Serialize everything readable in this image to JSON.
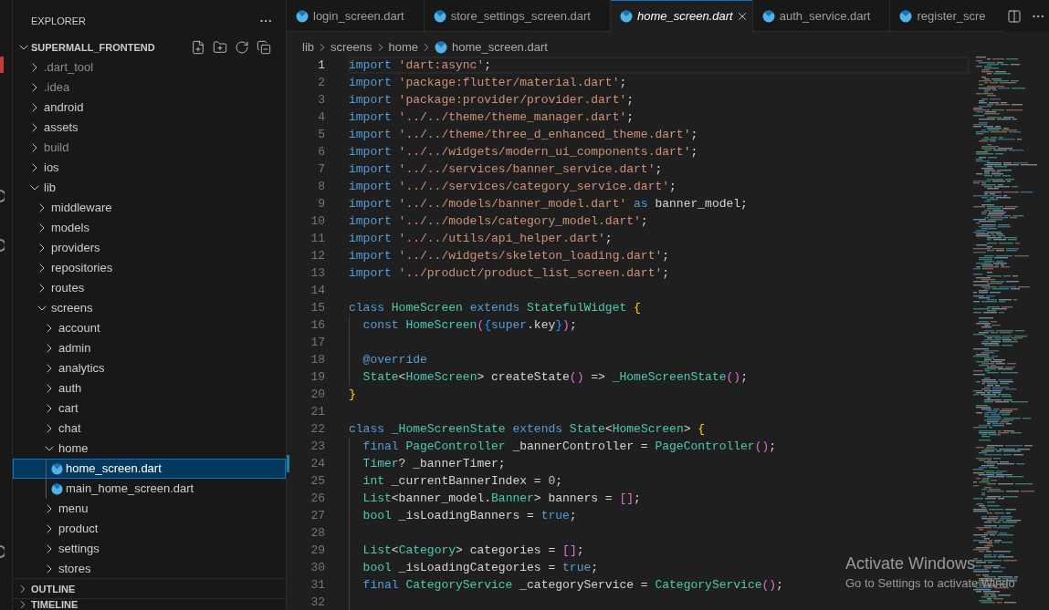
{
  "sidebar": {
    "title": "EXPLORER",
    "root": {
      "label": "SUPERMALL_FRONTEND",
      "expanded": true,
      "children": [
        {
          "label": ".dart_tool",
          "kind": "folder",
          "expanded": false,
          "selected": false,
          "ignored": true
        },
        {
          "label": ".idea",
          "kind": "folder",
          "expanded": false,
          "selected": false,
          "ignored": true
        },
        {
          "label": "android",
          "kind": "folder",
          "expanded": false,
          "selected": false,
          "ignored": false
        },
        {
          "label": "assets",
          "kind": "folder",
          "expanded": false,
          "selected": false,
          "ignored": false
        },
        {
          "label": "build",
          "kind": "folder",
          "expanded": false,
          "selected": false,
          "ignored": true
        },
        {
          "label": "ios",
          "kind": "folder",
          "expanded": false,
          "selected": false,
          "ignored": false
        },
        {
          "label": "lib",
          "kind": "folder",
          "expanded": true,
          "selected": false,
          "ignored": false,
          "children": [
            {
              "label": "middleware",
              "kind": "folder",
              "expanded": false,
              "selected": false,
              "ignored": false
            },
            {
              "label": "models",
              "kind": "folder",
              "expanded": false,
              "selected": false,
              "ignored": false
            },
            {
              "label": "providers",
              "kind": "folder",
              "expanded": false,
              "selected": false,
              "ignored": false
            },
            {
              "label": "repositories",
              "kind": "folder",
              "expanded": false,
              "selected": false,
              "ignored": false
            },
            {
              "label": "routes",
              "kind": "folder",
              "expanded": false,
              "selected": false,
              "ignored": false
            },
            {
              "label": "screens",
              "kind": "folder",
              "expanded": true,
              "selected": false,
              "ignored": false,
              "children": [
                {
                  "label": "account",
                  "kind": "folder",
                  "expanded": false,
                  "selected": false,
                  "ignored": false
                },
                {
                  "label": "admin",
                  "kind": "folder",
                  "expanded": false,
                  "selected": false,
                  "ignored": false
                },
                {
                  "label": "analytics",
                  "kind": "folder",
                  "expanded": false,
                  "selected": false,
                  "ignored": false
                },
                {
                  "label": "auth",
                  "kind": "folder",
                  "expanded": false,
                  "selected": false,
                  "ignored": false
                },
                {
                  "label": "cart",
                  "kind": "folder",
                  "expanded": false,
                  "selected": false,
                  "ignored": false
                },
                {
                  "label": "chat",
                  "kind": "folder",
                  "expanded": false,
                  "selected": false,
                  "ignored": false
                },
                {
                  "label": "home",
                  "kind": "folder",
                  "expanded": true,
                  "selected": false,
                  "ignored": false,
                  "children": [
                    {
                      "label": "home_screen.dart",
                      "kind": "file",
                      "selected": true,
                      "ignored": false
                    },
                    {
                      "label": "main_home_screen.dart",
                      "kind": "file",
                      "selected": false,
                      "ignored": false
                    }
                  ]
                },
                {
                  "label": "menu",
                  "kind": "folder",
                  "expanded": false,
                  "selected": false,
                  "ignored": false
                },
                {
                  "label": "product",
                  "kind": "folder",
                  "expanded": false,
                  "selected": false,
                  "ignored": false
                },
                {
                  "label": "settings",
                  "kind": "folder",
                  "expanded": false,
                  "selected": false,
                  "ignored": false
                },
                {
                  "label": "stores",
                  "kind": "folder",
                  "expanded": false,
                  "selected": false,
                  "ignored": false
                }
              ]
            }
          ]
        }
      ]
    },
    "sections": [
      {
        "label": "OUTLINE",
        "expanded": false
      },
      {
        "label": "TIMELINE",
        "expanded": false
      }
    ]
  },
  "editor": {
    "tabs": [
      {
        "label": "login_screen.dart",
        "selected": false,
        "preview": false
      },
      {
        "label": "store_settings_screen.dart",
        "selected": false,
        "preview": false
      },
      {
        "label": "home_screen.dart",
        "selected": true,
        "preview": true
      },
      {
        "label": "auth_service.dart",
        "selected": false,
        "preview": false
      },
      {
        "label": "register_scre",
        "selected": false,
        "preview": false
      }
    ],
    "breadcrumbs": {
      "folders": [
        "lib",
        "screens",
        "home"
      ],
      "file": "home_screen.dart"
    },
    "lines": [
      {
        "number": "1",
        "current": true,
        "modified": false,
        "tokens": [
          {
            "kind": "keyword",
            "text": "import "
          },
          {
            "kind": "string",
            "text": "'dart:async'"
          },
          {
            "kind": "plain",
            "text": ";"
          }
        ]
      },
      {
        "number": "2",
        "current": false,
        "modified": false,
        "tokens": [
          {
            "kind": "keyword",
            "text": "import "
          },
          {
            "kind": "string",
            "text": "'package:flutter/material.dart'"
          },
          {
            "kind": "plain",
            "text": ";"
          }
        ]
      },
      {
        "number": "3",
        "current": false,
        "modified": false,
        "tokens": [
          {
            "kind": "keyword",
            "text": "import "
          },
          {
            "kind": "string",
            "text": "'package:provider/provider.dart'"
          },
          {
            "kind": "plain",
            "text": ";"
          }
        ]
      },
      {
        "number": "4",
        "current": false,
        "modified": false,
        "tokens": [
          {
            "kind": "keyword",
            "text": "import "
          },
          {
            "kind": "string",
            "text": "'../../theme/theme_manager.dart'"
          },
          {
            "kind": "plain",
            "text": ";"
          }
        ]
      },
      {
        "number": "5",
        "current": false,
        "modified": false,
        "tokens": [
          {
            "kind": "keyword",
            "text": "import "
          },
          {
            "kind": "string",
            "text": "'../../theme/three_d_enhanced_theme.dart'"
          },
          {
            "kind": "plain",
            "text": ";"
          }
        ]
      },
      {
        "number": "6",
        "current": false,
        "modified": false,
        "tokens": [
          {
            "kind": "keyword",
            "text": "import "
          },
          {
            "kind": "string",
            "text": "'../../widgets/modern_ui_components.dart'"
          },
          {
            "kind": "plain",
            "text": ";"
          }
        ]
      },
      {
        "number": "7",
        "current": false,
        "modified": false,
        "tokens": [
          {
            "kind": "keyword",
            "text": "import "
          },
          {
            "kind": "string",
            "text": "'../../services/banner_service.dart'"
          },
          {
            "kind": "plain",
            "text": ";"
          }
        ]
      },
      {
        "number": "8",
        "current": false,
        "modified": false,
        "tokens": [
          {
            "kind": "keyword",
            "text": "import "
          },
          {
            "kind": "string",
            "text": "'../../services/category_service.dart'"
          },
          {
            "kind": "plain",
            "text": ";"
          }
        ]
      },
      {
        "number": "9",
        "current": false,
        "modified": false,
        "tokens": [
          {
            "kind": "keyword",
            "text": "import "
          },
          {
            "kind": "string",
            "text": "'../../models/banner_model.dart'"
          },
          {
            "kind": "keyword",
            "text": " as "
          },
          {
            "kind": "plain",
            "text": "banner_model;"
          }
        ]
      },
      {
        "number": "10",
        "current": false,
        "modified": false,
        "tokens": [
          {
            "kind": "keyword",
            "text": "import "
          },
          {
            "kind": "string",
            "text": "'../../models/category_model.dart'"
          },
          {
            "kind": "plain",
            "text": ";"
          }
        ]
      },
      {
        "number": "11",
        "current": false,
        "modified": false,
        "tokens": [
          {
            "kind": "keyword",
            "text": "import "
          },
          {
            "kind": "string",
            "text": "'../../utils/api_helper.dart'"
          },
          {
            "kind": "plain",
            "text": ";"
          }
        ]
      },
      {
        "number": "12",
        "current": false,
        "modified": false,
        "tokens": [
          {
            "kind": "keyword",
            "text": "import "
          },
          {
            "kind": "string",
            "text": "'../../widgets/skeleton_loading.dart'"
          },
          {
            "kind": "plain",
            "text": ";"
          }
        ]
      },
      {
        "number": "13",
        "current": false,
        "modified": false,
        "tokens": [
          {
            "kind": "keyword",
            "text": "import "
          },
          {
            "kind": "string",
            "text": "'../product/product_list_screen.dart'"
          },
          {
            "kind": "plain",
            "text": ";"
          }
        ]
      },
      {
        "number": "14",
        "current": false,
        "modified": false
      },
      {
        "number": "15",
        "current": false,
        "modified": false,
        "tokens": [
          {
            "kind": "keyword",
            "text": "class "
          },
          {
            "kind": "type",
            "text": "HomeScreen"
          },
          {
            "kind": "keyword",
            "text": " extends "
          },
          {
            "kind": "type",
            "text": "StatefulWidget"
          },
          {
            "kind": "bracket_outer",
            "text": " {"
          }
        ],
        "children": [
          {
            "number": "16",
            "current": false,
            "modified": false,
            "tokens": [
              {
                "kind": "keyword",
                "text": "const "
              },
              {
                "kind": "type",
                "text": "HomeScreen"
              },
              {
                "kind": "bracket_middle",
                "text": "("
              },
              {
                "kind": "bracket_inner",
                "text": "{"
              },
              {
                "kind": "keyword",
                "text": "super"
              },
              {
                "kind": "plain",
                "text": ".key"
              },
              {
                "kind": "bracket_inner",
                "text": "}"
              },
              {
                "kind": "bracket_middle",
                "text": ")"
              },
              {
                "kind": "plain",
                "text": ";"
              }
            ]
          },
          {
            "number": "17",
            "current": false,
            "modified": false
          },
          {
            "number": "18",
            "current": false,
            "modified": false,
            "tokens": [
              {
                "kind": "keyword",
                "text": "@override"
              }
            ]
          },
          {
            "number": "19",
            "current": false,
            "modified": false,
            "tokens": [
              {
                "kind": "type",
                "text": "State"
              },
              {
                "kind": "plain",
                "text": "<"
              },
              {
                "kind": "type",
                "text": "HomeScreen"
              },
              {
                "kind": "plain",
                "text": "> createState"
              },
              {
                "kind": "bracket_middle",
                "text": "()"
              },
              {
                "kind": "plain",
                "text": " => "
              },
              {
                "kind": "type",
                "text": "_HomeScreenState"
              },
              {
                "kind": "bracket_middle",
                "text": "()"
              },
              {
                "kind": "plain",
                "text": ";"
              }
            ]
          }
        ]
      },
      {
        "number": "20",
        "current": false,
        "modified": false,
        "tokens": [
          {
            "kind": "bracket_outer",
            "text": "}"
          }
        ]
      },
      {
        "number": "21",
        "current": false,
        "modified": false
      },
      {
        "number": "22",
        "current": false,
        "modified": false,
        "tokens": [
          {
            "kind": "keyword",
            "text": "class "
          },
          {
            "kind": "type",
            "text": "_HomeScreenState"
          },
          {
            "kind": "keyword",
            "text": " extends "
          },
          {
            "kind": "type",
            "text": "State"
          },
          {
            "kind": "plain",
            "text": "<"
          },
          {
            "kind": "type",
            "text": "HomeScreen"
          },
          {
            "kind": "plain",
            "text": ">"
          },
          {
            "kind": "bracket_outer",
            "text": " {"
          }
        ],
        "children": [
          {
            "number": "23",
            "current": false,
            "modified": false,
            "tokens": [
              {
                "kind": "keyword",
                "text": "final "
              },
              {
                "kind": "type",
                "text": "PageController"
              },
              {
                "kind": "plain",
                "text": " _bannerController = "
              },
              {
                "kind": "type",
                "text": "PageController"
              },
              {
                "kind": "bracket_middle",
                "text": "()"
              },
              {
                "kind": "plain",
                "text": ";"
              }
            ]
          },
          {
            "number": "24",
            "current": false,
            "modified": true,
            "tokens": [
              {
                "kind": "type",
                "text": "Timer"
              },
              {
                "kind": "plain",
                "text": "? _bannerTimer;"
              }
            ]
          },
          {
            "number": "25",
            "current": false,
            "modified": false,
            "tokens": [
              {
                "kind": "type",
                "text": "int"
              },
              {
                "kind": "plain",
                "text": " _currentBannerIndex = "
              },
              {
                "kind": "number",
                "text": "0"
              },
              {
                "kind": "plain",
                "text": ";"
              }
            ]
          },
          {
            "number": "26",
            "current": false,
            "modified": false,
            "tokens": [
              {
                "kind": "type",
                "text": "List"
              },
              {
                "kind": "plain",
                "text": "<banner_model."
              },
              {
                "kind": "type",
                "text": "Banner"
              },
              {
                "kind": "plain",
                "text": "> banners = "
              },
              {
                "kind": "bracket_middle",
                "text": "[]"
              },
              {
                "kind": "plain",
                "text": ";"
              }
            ]
          },
          {
            "number": "27",
            "current": false,
            "modified": false,
            "tokens": [
              {
                "kind": "type",
                "text": "bool"
              },
              {
                "kind": "plain",
                "text": " _isLoadingBanners = "
              },
              {
                "kind": "keyword",
                "text": "true"
              },
              {
                "kind": "plain",
                "text": ";"
              }
            ]
          },
          {
            "number": "28",
            "current": false,
            "modified": false
          },
          {
            "number": "29",
            "current": false,
            "modified": false,
            "tokens": [
              {
                "kind": "type",
                "text": "List"
              },
              {
                "kind": "plain",
                "text": "<"
              },
              {
                "kind": "type",
                "text": "Category"
              },
              {
                "kind": "plain",
                "text": "> categories = "
              },
              {
                "kind": "bracket_middle",
                "text": "[]"
              },
              {
                "kind": "plain",
                "text": ";"
              }
            ]
          },
          {
            "number": "30",
            "current": false,
            "modified": false,
            "tokens": [
              {
                "kind": "type",
                "text": "bool"
              },
              {
                "kind": "plain",
                "text": " _isLoadingCategories = "
              },
              {
                "kind": "keyword",
                "text": "true"
              },
              {
                "kind": "plain",
                "text": ";"
              }
            ]
          },
          {
            "number": "31",
            "current": false,
            "modified": false,
            "tokens": [
              {
                "kind": "keyword",
                "text": "final "
              },
              {
                "kind": "type",
                "text": "CategoryService"
              },
              {
                "kind": "plain",
                "text": " _categoryService = "
              },
              {
                "kind": "type",
                "text": "CategoryService"
              },
              {
                "kind": "bracket_middle",
                "text": "()"
              },
              {
                "kind": "plain",
                "text": ";"
              }
            ]
          },
          {
            "number": "32",
            "current": false,
            "modified": false
          }
        ]
      }
    ]
  },
  "os_notice": {
    "title": "Activate Windows",
    "message": "Go to Settings to activate Windo"
  }
}
